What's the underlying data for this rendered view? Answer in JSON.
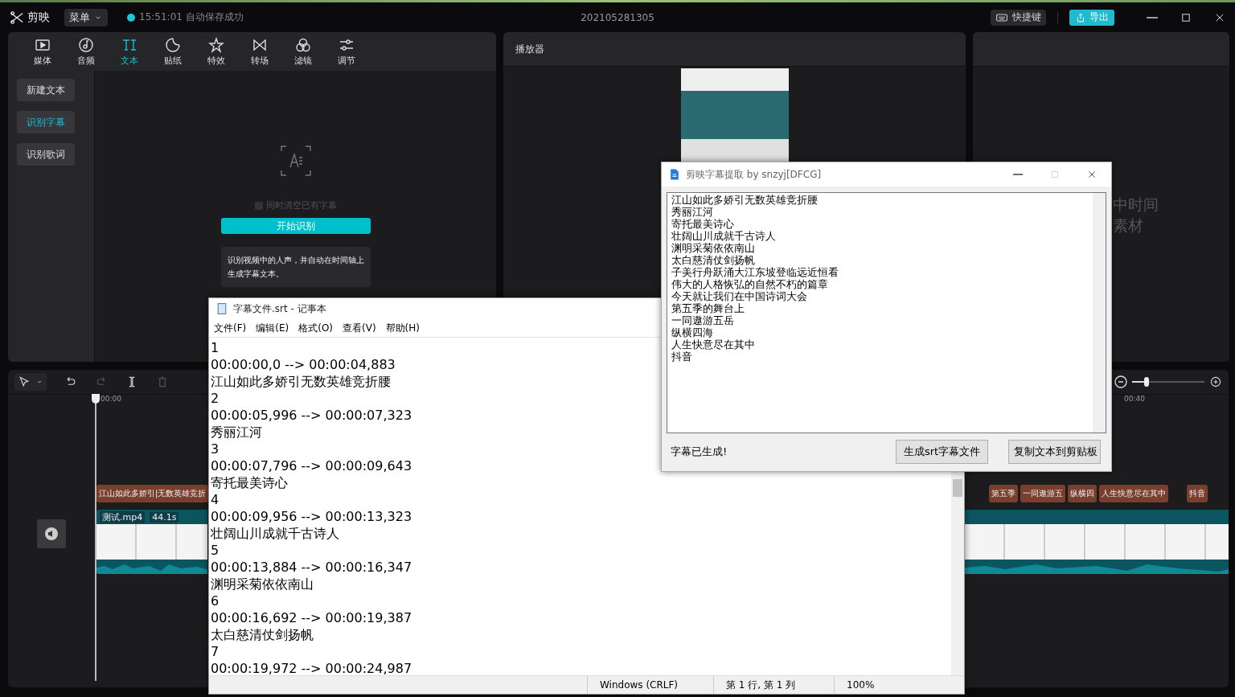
{
  "app": {
    "logo_text": "剪映",
    "menu_button": "菜单",
    "save_status": "15:51:01 自动保存成功",
    "project_name": "202105281305",
    "shortcut_button": "快捷键",
    "export_button": "导出"
  },
  "media_panel": {
    "tabs": [
      {
        "kind": "media",
        "label": "媒体",
        "selected": false
      },
      {
        "kind": "audio",
        "label": "音频",
        "selected": false
      },
      {
        "kind": "text",
        "label": "文本",
        "selected": true
      },
      {
        "kind": "sticker",
        "label": "贴纸",
        "selected": false
      },
      {
        "kind": "effect",
        "label": "特效",
        "selected": false
      },
      {
        "kind": "transition",
        "label": "转场",
        "selected": false
      },
      {
        "kind": "filter",
        "label": "滤镜",
        "selected": false
      },
      {
        "kind": "adjust",
        "label": "调节",
        "selected": false
      }
    ],
    "side_items": [
      {
        "label": "新建文本",
        "selected": false
      },
      {
        "label": "识别字幕",
        "selected": true
      },
      {
        "label": "识别歌词",
        "selected": false
      }
    ],
    "clear_existing": {
      "label": "同时清空已有字幕",
      "checked": false
    },
    "start_button": "开始识别",
    "hint": "识别视频中的人声，并自动在时间轴上生成字幕文本。"
  },
  "player": {
    "title": "播放器"
  },
  "properties_panel": {
    "hint_lines": [
      "中时间",
      "素材"
    ]
  },
  "timeline": {
    "tools": [
      {
        "kind": "undo",
        "disabled": false
      },
      {
        "kind": "redo",
        "disabled": true
      },
      {
        "kind": "split",
        "disabled": false
      },
      {
        "kind": "delete",
        "disabled": true
      }
    ],
    "ruler_labels": [
      "00:00",
      "00:40"
    ],
    "zoom": {
      "level": 0.2
    },
    "text_clips_left": [
      "江山如此多娇引|无数英雄竞折"
    ],
    "text_clips_right": [
      "第五季",
      "一同遨游五",
      "纵横四",
      "人生快意尽在其中",
      "抖音"
    ],
    "video_clip": {
      "name": "测试.mp4",
      "duration": "44.1s"
    }
  },
  "notepad": {
    "title": "字幕文件.srt - 记事本",
    "menu": [
      "文件(F)",
      "编辑(E)",
      "格式(O)",
      "查看(V)",
      "帮助(H)"
    ],
    "lines": [
      "1",
      "00:00:00,0 --> 00:00:04,883",
      "江山如此多娇引无数英雄竞折腰",
      "2",
      "00:00:05,996 --> 00:00:07,323",
      "秀丽江河",
      "3",
      "00:00:07,796 --> 00:00:09,643",
      "寄托最美诗心",
      "4",
      "00:00:09,956 --> 00:00:13,323",
      "壮阔山川成就千古诗人",
      "5",
      "00:00:13,884 --> 00:00:16,347",
      "渊明采菊依依南山",
      "6",
      "00:00:16,692 --> 00:00:19,387",
      "太白慈清仗剑扬帆",
      "7",
      "00:00:19,972 --> 00:00:24,987"
    ],
    "status": [
      "Windows (CRLF)",
      "第 1 行, 第 1 列",
      "100%"
    ]
  },
  "extractor": {
    "title": "剪映字幕提取 by snzyj[DFCG]",
    "lines": [
      "江山如此多娇引无数英雄竞折腰",
      "秀丽江河",
      "寄托最美诗心",
      "壮阔山川成就千古诗人",
      "渊明采菊依依南山",
      "太白慈清仗剑扬帆",
      "子美行舟跃涌大江东坡登临远近恒看",
      "伟大的人格恢弘的自然不朽的篇章",
      "今天就让我们在中国诗词大会",
      "第五季的舞台上",
      "一同遨游五岳",
      "纵横四海",
      "人生快意尽在其中",
      "抖音"
    ],
    "status": "字幕已生成!",
    "buttons": [
      "生成srt字幕文件",
      "复制文本到剪贴板"
    ]
  }
}
